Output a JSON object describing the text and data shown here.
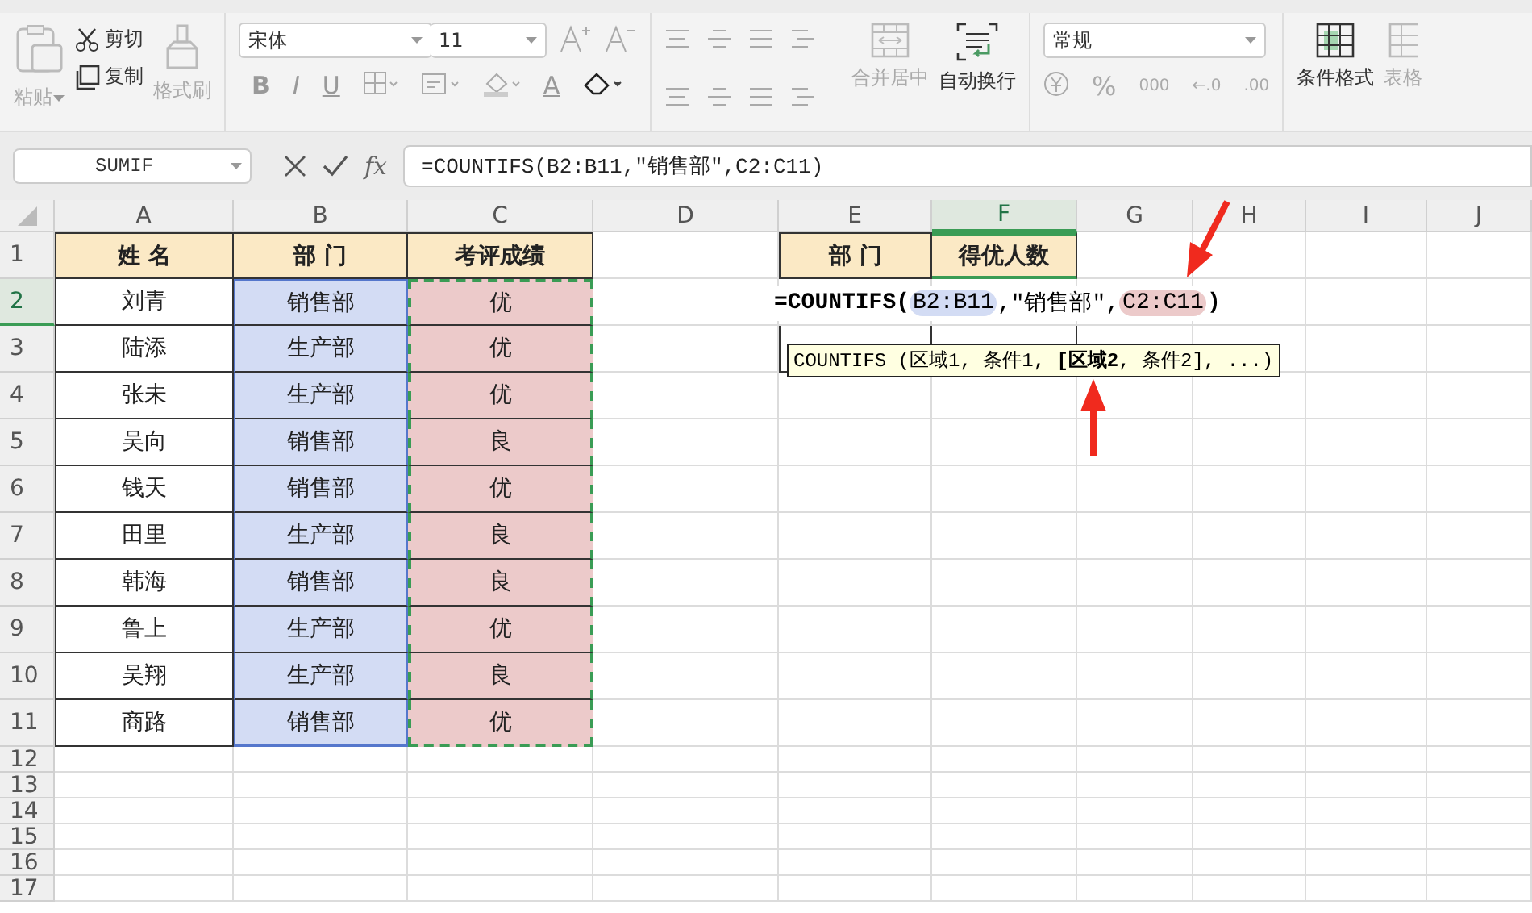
{
  "ribbon": {
    "clipboard": [
      {
        "kind": "paste",
        "label": "粘贴",
        "disabled": true
      },
      {
        "kind": "cut",
        "label": "剪切",
        "disabled": false
      },
      {
        "kind": "copy",
        "label": "复制",
        "disabled": false
      },
      {
        "kind": "painter",
        "label": "格式刷",
        "disabled": true
      }
    ],
    "font": {
      "name": "宋体",
      "size": "11",
      "styles": [
        {
          "kind": "text",
          "label": "B"
        },
        {
          "kind": "text",
          "label": "I"
        },
        {
          "kind": "text",
          "label": "U"
        },
        {
          "kind": "border"
        },
        {
          "kind": "fill"
        },
        {
          "kind": "bucket"
        },
        {
          "kind": "color",
          "label": "A"
        },
        {
          "kind": "eraser"
        }
      ]
    },
    "merge": {
      "label": "合并居中",
      "disabled": true
    },
    "wrap": {
      "label": "自动换行",
      "disabled": false
    },
    "number_format": "常规",
    "number_buttons": [
      "%",
      "000",
      "←.0",
      ".00"
    ],
    "conditional": {
      "label": "条件格式",
      "disabled": false
    },
    "table_style": {
      "label": "表格",
      "disabled": true
    }
  },
  "formula_bar": {
    "name_box": "SUMIF",
    "fx": "fx",
    "formula": "=COUNTIFS(B2:B11,\"销售部\",C2:C11)"
  },
  "sheet": {
    "columns": [
      {
        "label": "A",
        "selected": false
      },
      {
        "label": "B",
        "selected": false
      },
      {
        "label": "C",
        "selected": false
      },
      {
        "label": "D",
        "selected": false
      },
      {
        "label": "E",
        "selected": false
      },
      {
        "label": "F",
        "selected": true
      },
      {
        "label": "G",
        "selected": false
      },
      {
        "label": "H",
        "selected": false
      },
      {
        "label": "I",
        "selected": false
      },
      {
        "label": "J",
        "selected": false
      }
    ],
    "rows": [
      {
        "label": "1",
        "selected": false
      },
      {
        "label": "2",
        "selected": true
      },
      {
        "label": "3",
        "selected": false
      },
      {
        "label": "4",
        "selected": false
      },
      {
        "label": "5",
        "selected": false
      },
      {
        "label": "6",
        "selected": false
      },
      {
        "label": "7",
        "selected": false
      },
      {
        "label": "8",
        "selected": false
      },
      {
        "label": "9",
        "selected": false
      },
      {
        "label": "10",
        "selected": false
      },
      {
        "label": "11",
        "selected": false
      },
      {
        "label": "12",
        "selected": false
      },
      {
        "label": "13",
        "selected": false
      },
      {
        "label": "14",
        "selected": false
      },
      {
        "label": "15",
        "selected": false
      },
      {
        "label": "16",
        "selected": false
      },
      {
        "label": "17",
        "selected": false
      }
    ],
    "table": {
      "headers": [
        "姓 名",
        "部 门",
        "考评成绩"
      ],
      "rows": [
        [
          "刘青",
          "销售部",
          "优"
        ],
        [
          "陆添",
          "生产部",
          "优"
        ],
        [
          "张未",
          "生产部",
          "优"
        ],
        [
          "吴向",
          "销售部",
          "良"
        ],
        [
          "钱天",
          "销售部",
          "优"
        ],
        [
          "田里",
          "生产部",
          "良"
        ],
        [
          "韩海",
          "销售部",
          "良"
        ],
        [
          "鲁上",
          "生产部",
          "优"
        ],
        [
          "吴翔",
          "生产部",
          "良"
        ],
        [
          "商路",
          "销售部",
          "优"
        ]
      ]
    },
    "summary": {
      "headers": [
        "部 门",
        "得优人数"
      ]
    },
    "editing": {
      "parts": [
        {
          "kind": "text",
          "text": "=COUNTIFS("
        },
        {
          "kind": "ref",
          "text": "B2:B11",
          "color": "#d3dcf4"
        },
        {
          "kind": "text",
          "text": ",\"销售部\","
        },
        {
          "kind": "ref",
          "text": "C2:C11",
          "color": "#eccaca"
        },
        {
          "kind": "text",
          "text": ")"
        }
      ]
    },
    "tooltip": "COUNTIFS (区域1, 条件1, **[区域2**, 条件2], ...)"
  }
}
